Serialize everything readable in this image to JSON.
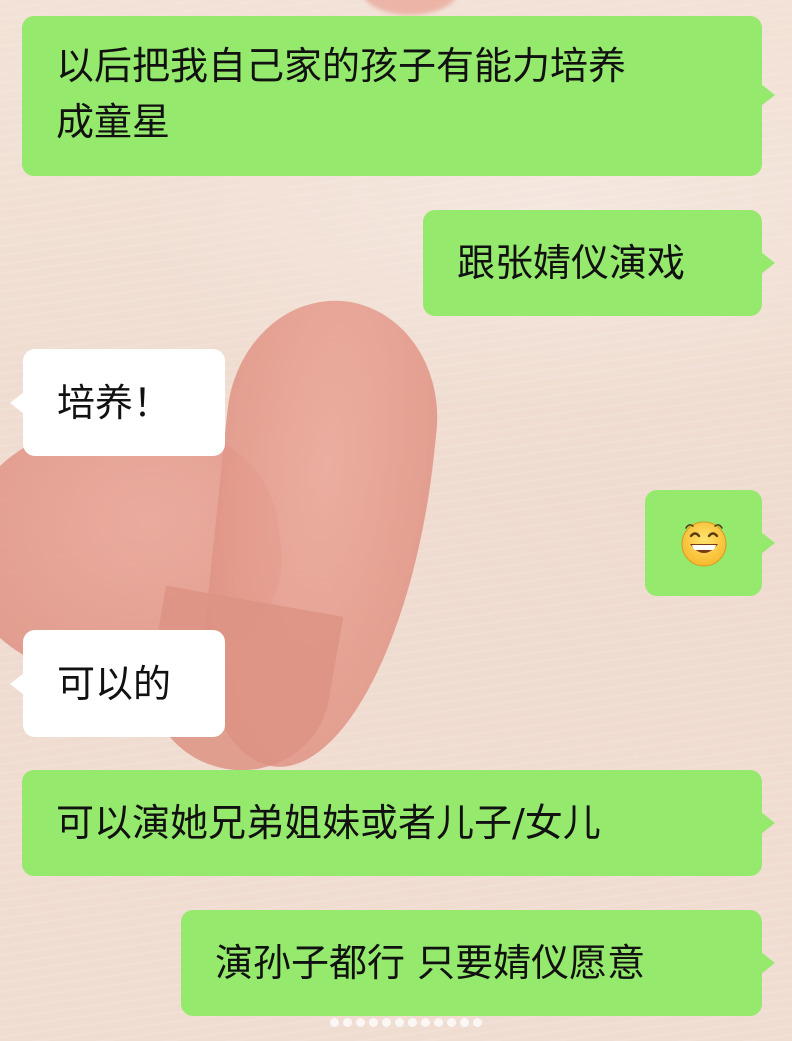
{
  "chat": {
    "messages": [
      {
        "side": "out",
        "text": "以后把我自己家的孩子有能力培养\n成童星"
      },
      {
        "side": "out",
        "text": "跟张婧仪演戏"
      },
      {
        "side": "in",
        "text": "培养！"
      },
      {
        "side": "out",
        "emoji": "grinning-face-emoji"
      },
      {
        "side": "in",
        "text": "可以的"
      },
      {
        "side": "out",
        "text": "可以演她兄弟姐妹或者儿子/女儿"
      },
      {
        "side": "out",
        "text": "演孙子都行 只要婧仪愿意"
      }
    ]
  },
  "colors": {
    "outgoing_bubble": "#95e96c",
    "incoming_bubble": "#ffffff",
    "background": "#efdcd0",
    "heart": "#e39a8b"
  }
}
